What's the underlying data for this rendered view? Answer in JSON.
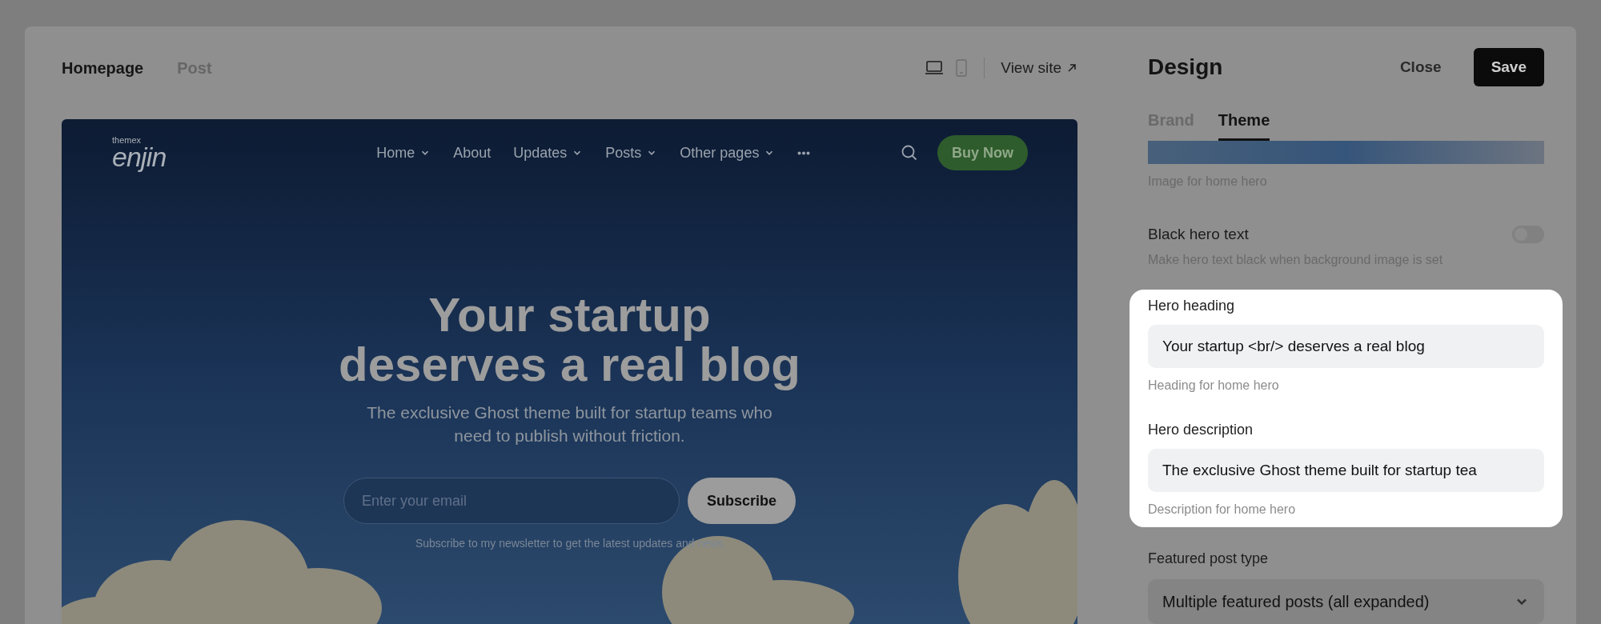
{
  "page_tabs": [
    {
      "label": "Homepage",
      "selected": true
    },
    {
      "label": "Post",
      "selected": false
    }
  ],
  "device_toggles": [
    {
      "kind": "desktop",
      "selected": true
    },
    {
      "kind": "mobile",
      "selected": false
    }
  ],
  "view_site": {
    "label": "View site"
  },
  "preview": {
    "logo": {
      "small": "themex",
      "name": "enjin"
    },
    "nav": [
      {
        "label": "Home",
        "kind": "dropdown"
      },
      {
        "label": "About",
        "kind": "link"
      },
      {
        "label": "Updates",
        "kind": "dropdown"
      },
      {
        "label": "Posts",
        "kind": "dropdown"
      },
      {
        "label": "Other pages",
        "kind": "dropdown"
      },
      {
        "kind": "more"
      }
    ],
    "cta": "Buy Now",
    "hero": {
      "heading_lines": [
        "Your startup",
        "deserves a real blog"
      ],
      "subtitle_lines": [
        "The exclusive Ghost theme built for startup teams who",
        "need to publish without friction."
      ],
      "email_placeholder": "Enter your email",
      "subscribe": "Subscribe",
      "note": "Subscribe to my newsletter to get the latest updates and news"
    }
  },
  "panel": {
    "title": "Design",
    "close": "Close",
    "save": "Save",
    "tabs": [
      {
        "label": "Brand",
        "selected": false
      },
      {
        "label": "Theme",
        "selected": true
      }
    ],
    "settings": [
      {
        "kind": "image",
        "hint": "Image for home hero"
      },
      {
        "kind": "toggle",
        "label": "Black hero text",
        "hint": "Make hero text black when background image is set",
        "on": false
      },
      {
        "kind": "text",
        "label": "Hero heading",
        "value": "Your startup <br/> deserves a real blog",
        "hint": "Heading for home hero",
        "highlighted": true
      },
      {
        "kind": "text",
        "label": "Hero description",
        "value": "The exclusive Ghost theme built for startup tea",
        "hint": "Description for home hero",
        "highlighted": true
      },
      {
        "kind": "select",
        "label": "Featured post type",
        "value": "Multiple featured posts (all expanded)"
      }
    ]
  }
}
